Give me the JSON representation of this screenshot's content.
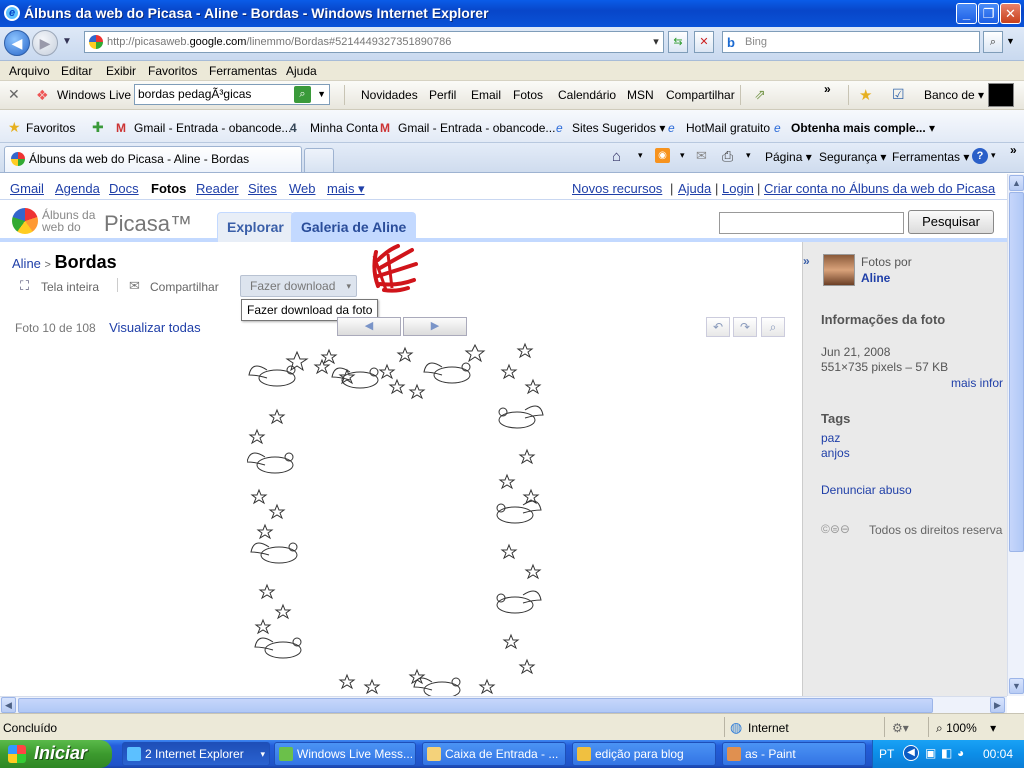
{
  "window": {
    "title": "Álbuns da web do Picasa - Aline - Bordas - Windows Internet Explorer"
  },
  "address": {
    "url_prefix": "http://picasaweb.",
    "url_domain": "google.com",
    "url_suffix": "/linemmo/Bordas#5214449327351890786",
    "search_placeholder": "Bing"
  },
  "menu": [
    "Arquivo",
    "Editar",
    "Exibir",
    "Favoritos",
    "Ferramentas",
    "Ajuda"
  ],
  "live_toolbar": {
    "brand": "Windows Live",
    "search_value": "bordas pedagÃ³gicas",
    "links": [
      "Novidades",
      "Perfil",
      "Email",
      "Fotos",
      "Calendário",
      "MSN",
      "Compartilhar"
    ],
    "banco": "Banco de"
  },
  "favorites": {
    "label": "Favoritos",
    "items": [
      "Gmail - Entrada - obancode...",
      "Minha Conta",
      "Gmail - Entrada - obancode...",
      "Sites Sugeridos",
      "HotMail gratuito",
      "Obtenha mais comple..."
    ]
  },
  "tabs": {
    "active": "Álbuns da web do Picasa - Aline - Bordas",
    "commands": [
      "Página",
      "Segurança",
      "Ferramentas"
    ]
  },
  "google_bar": {
    "links": [
      "Gmail",
      "Agenda",
      "Docs",
      "Fotos",
      "Reader",
      "Sites",
      "Web",
      "mais ▾"
    ],
    "right": [
      "Novos recursos",
      "Ajuda",
      "Login",
      "Criar conta no Álbuns da web do Picasa"
    ]
  },
  "picasa": {
    "logo_line1": "Álbuns da",
    "logo_line2": "web do",
    "logo_word": "Picasa™",
    "tab_explore": "Explorar",
    "tab_gallery": "Galeria de Aline",
    "search_button": "Pesquisar",
    "crumb_user": "Aline",
    "crumb_sep": ">",
    "album_title": "Bordas",
    "action_fullscreen": "Tela inteira",
    "action_share": "Compartilhar",
    "action_download": "Fazer download",
    "tooltip": "Fazer download da foto",
    "photo_counter": "Foto 10 de 108",
    "view_all": "Visualizar todas"
  },
  "side": {
    "photos_by": "Fotos por",
    "owner": "Aline",
    "info_title": "Informações da foto",
    "date": "Jun 21, 2008",
    "dims": "551×735 pixels – 57 KB",
    "more_info": "mais infor",
    "tags_title": "Tags",
    "tags": [
      "paz",
      "anjos"
    ],
    "report": "Denunciar abuso",
    "rights": "Todos os direitos reserva"
  },
  "status": {
    "text": "Concluído",
    "zone": "Internet",
    "zoom": "100%"
  },
  "taskbar": {
    "start": "Iniciar",
    "tasks": [
      "2 Internet Explorer",
      "Windows Live Mess...",
      "Caixa de Entrada - ...",
      "edição para blog",
      "as - Paint"
    ],
    "lang": "PT",
    "clock": "00:04"
  }
}
